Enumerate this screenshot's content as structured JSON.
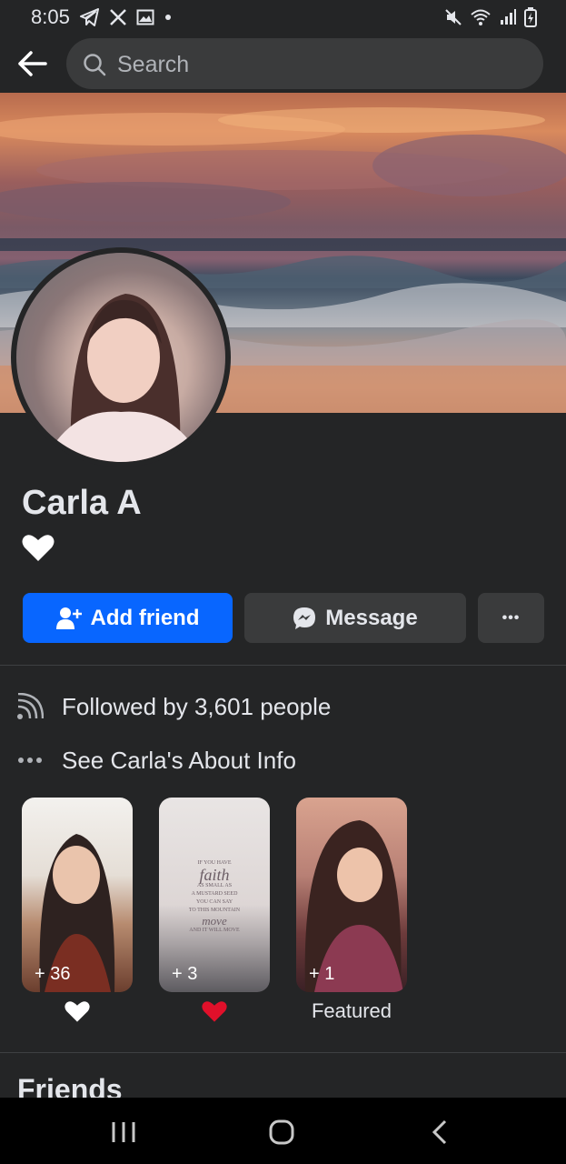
{
  "status_bar": {
    "time": "8:05",
    "left_icons": [
      "telegram-icon",
      "x-icon",
      "gallery-icon",
      "dot-icon"
    ],
    "right_icons": [
      "mute-icon",
      "wifi-icon",
      "signal-icon",
      "battery-icon"
    ]
  },
  "header": {
    "search_placeholder": "Search",
    "back_icon": "back-arrow-icon",
    "search_icon": "search-icon"
  },
  "profile": {
    "name": "Carla A",
    "bio_emoji": "white-heart",
    "add_friend_label": "Add friend",
    "message_label": "Message",
    "more_label": "•••"
  },
  "info": [
    {
      "icon": "followers-feed-icon",
      "text": "Followed by 3,601 people"
    },
    {
      "icon": "more-dots-icon",
      "text": "See Carla's About Info"
    }
  ],
  "highlights": [
    {
      "count": "+ 36",
      "label_emoji": "white-heart",
      "label": ""
    },
    {
      "count": "+ 3",
      "label_emoji": "red-heart",
      "label": ""
    },
    {
      "count": "+ 1",
      "label_emoji": "",
      "label": "Featured"
    }
  ],
  "quote_card_text": [
    "IF YOU HAVE",
    "faith",
    "AS SMALL AS",
    "A MUSTARD SEED",
    "YOU CAN SAY",
    "TO THIS MOUNTAIN",
    "move",
    "AND IT WILL MOVE"
  ],
  "friends_title": "Friends",
  "colors": {
    "background": "#242526",
    "primary_button": "#0866ff",
    "secondary_button": "#3a3b3c",
    "text": "#e4e6eb"
  },
  "nav_bar": [
    "recent-apps-icon",
    "home-icon",
    "back-icon"
  ]
}
